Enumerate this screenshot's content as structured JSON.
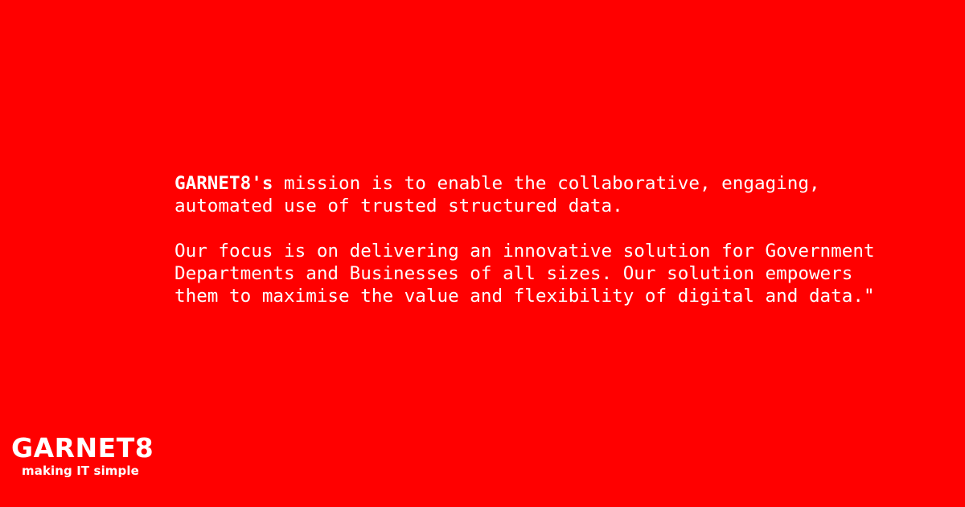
{
  "mission": {
    "brand": "GARNET8's",
    "line1_rest": " mission is to enable the collaborative, engaging,",
    "line2": "automated use of trusted structured data.",
    "line3": "Our focus is on delivering an innovative solution for Government",
    "line4": "Departments and Businesses of all sizes. Our solution empowers",
    "line5": "them to maximise the value and flexibility of digital and data.\""
  },
  "logo": {
    "name": "GARNET8",
    "tagline": "making IT simple"
  },
  "colors": {
    "background": "#ff0000",
    "text": "#ffffff"
  }
}
